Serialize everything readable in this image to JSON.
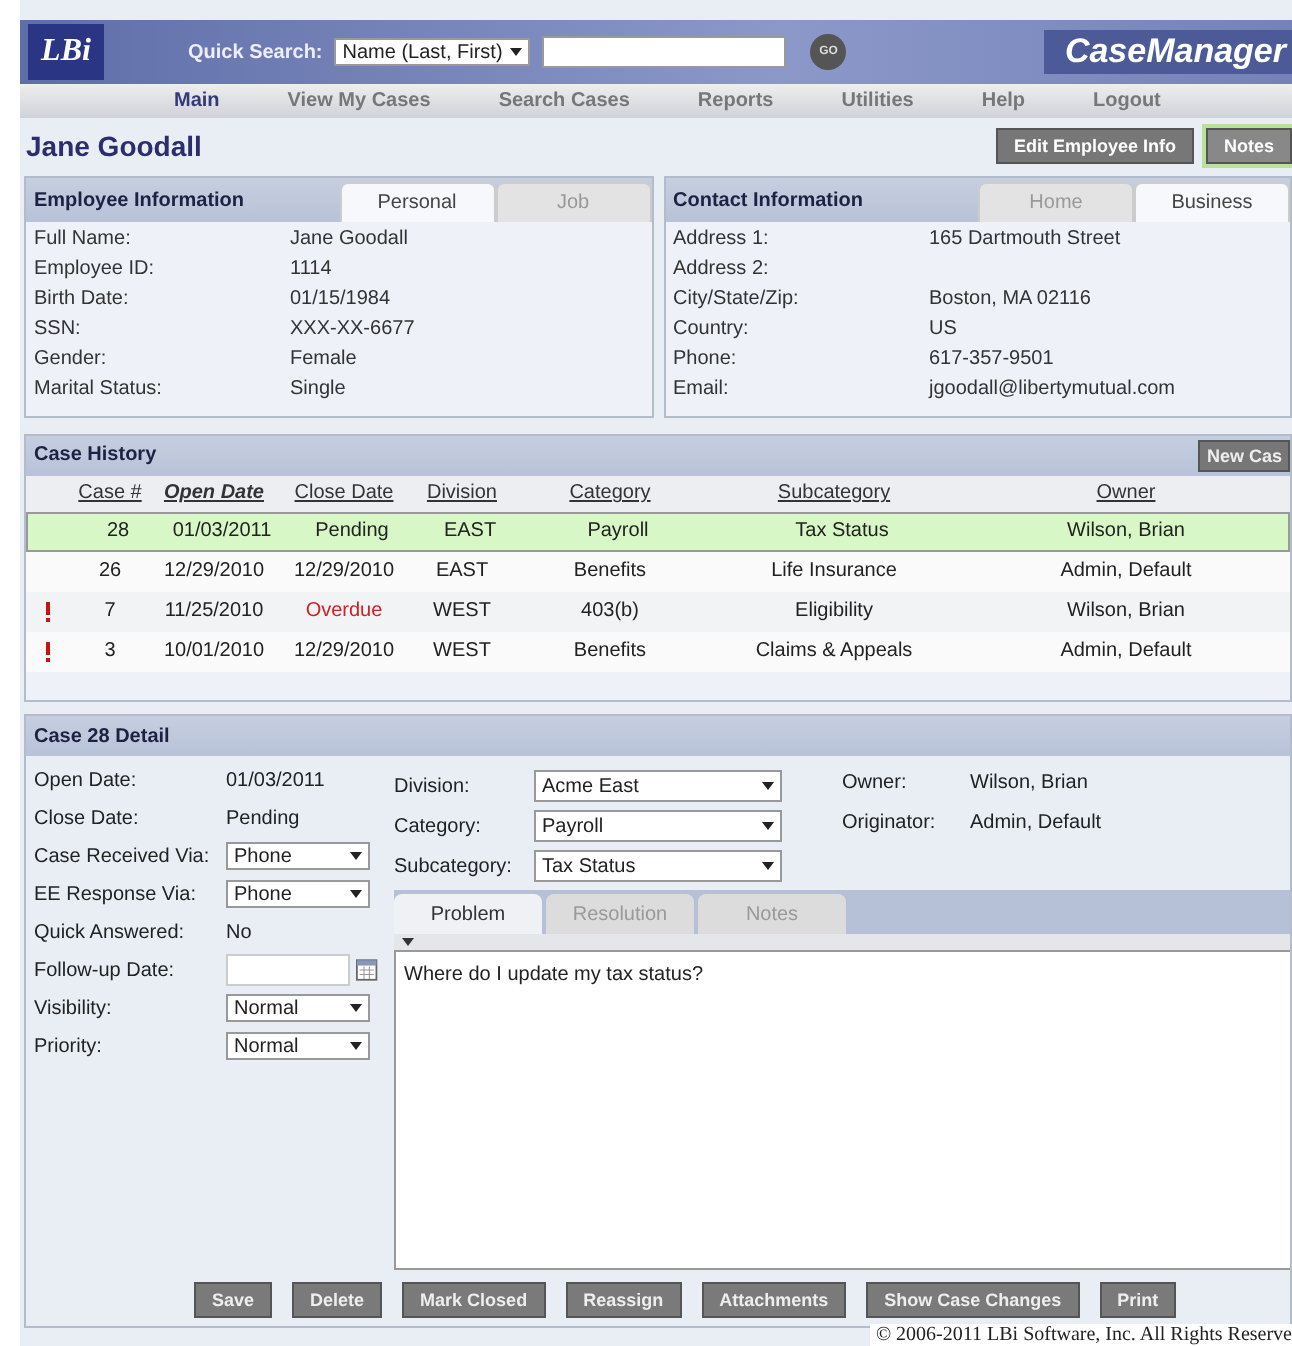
{
  "header": {
    "logo": "LBi",
    "quick_search_label": "Quick Search:",
    "search_type": "Name (Last, First)",
    "go": "GO",
    "product": "CaseManager"
  },
  "nav": [
    {
      "label": "Main",
      "selected": true
    },
    {
      "label": "View My Cases",
      "selected": false
    },
    {
      "label": "Search Cases",
      "selected": false
    },
    {
      "label": "Reports",
      "selected": false
    },
    {
      "label": "Utilities",
      "selected": false
    },
    {
      "label": "Help",
      "selected": false
    },
    {
      "label": "Logout",
      "selected": false
    }
  ],
  "employee_name": "Jane Goodall",
  "actions": [
    {
      "label": "Edit Employee Info",
      "kind": "plain"
    },
    {
      "label": "Notes",
      "kind": "highlight"
    }
  ],
  "employee_info": {
    "title": "Employee Information",
    "tabs": [
      {
        "label": "Personal",
        "selected": true
      },
      {
        "label": "Job",
        "selected": false
      }
    ],
    "fields": [
      {
        "label": "Full Name:",
        "value": "Jane Goodall"
      },
      {
        "label": "Employee ID:",
        "value": "1114"
      },
      {
        "label": "Birth Date:",
        "value": "01/15/1984"
      },
      {
        "label": "SSN:",
        "value": "XXX-XX-6677"
      },
      {
        "label": "Gender:",
        "value": "Female"
      },
      {
        "label": "Marital Status:",
        "value": "Single"
      }
    ]
  },
  "contact_info": {
    "title": "Contact Information",
    "tabs": [
      {
        "label": "Home",
        "selected": false
      },
      {
        "label": "Business",
        "selected": true
      }
    ],
    "fields": [
      {
        "label": "Address 1:",
        "value": "165 Dartmouth Street"
      },
      {
        "label": "Address 2:"
      },
      {
        "label": "City/State/Zip:",
        "value": "Boston, MA 02116"
      },
      {
        "label": "Country:",
        "value": "US"
      },
      {
        "label": "Phone:",
        "value": "617-357-9501"
      },
      {
        "label": "Email:",
        "value": "jgoodall@libertymutual.com"
      }
    ]
  },
  "case_history": {
    "title": "Case History",
    "new_button": "New Cas",
    "columns": [
      {
        "label": "Case #",
        "sorted": false
      },
      {
        "label": "Open Date",
        "sorted": true
      },
      {
        "label": "Close Date",
        "sorted": false
      },
      {
        "label": "Division",
        "sorted": false
      },
      {
        "label": "Category",
        "sorted": false
      },
      {
        "label": "Subcategory",
        "sorted": false
      },
      {
        "label": "Owner",
        "sorted": false
      }
    ],
    "rows": [
      {
        "flagged": false,
        "selected": true,
        "overdue": false,
        "cells": [
          "28",
          "01/03/2011",
          "Pending",
          "EAST",
          "Payroll",
          "Tax Status",
          "Wilson, Brian"
        ]
      },
      {
        "flagged": false,
        "selected": false,
        "overdue": false,
        "cells": [
          "26",
          "12/29/2010",
          "12/29/2010",
          "EAST",
          "Benefits",
          "Life Insurance",
          "Admin, Default"
        ]
      },
      {
        "flagged": true,
        "selected": false,
        "overdue": true,
        "cells": [
          "7",
          "11/25/2010",
          "Overdue",
          "WEST",
          "403(b)",
          "Eligibility",
          "Wilson, Brian"
        ]
      },
      {
        "flagged": true,
        "selected": false,
        "overdue": false,
        "cells": [
          "3",
          "10/01/2010",
          "12/29/2010",
          "WEST",
          "Benefits",
          "Claims & Appeals",
          "Admin, Default"
        ]
      }
    ]
  },
  "case_detail": {
    "title": "Case 28 Detail",
    "left_fields": [
      {
        "label": "Open Date:",
        "value": "01/03/2011",
        "kind": "text"
      },
      {
        "label": "Close Date:",
        "value": "Pending",
        "kind": "text"
      },
      {
        "label": "Case Received Via:",
        "value": "Phone",
        "kind": "select"
      },
      {
        "label": "EE Response Via:",
        "value": "Phone",
        "kind": "select"
      },
      {
        "label": "Quick Answered:",
        "value": "No",
        "kind": "text"
      },
      {
        "label": "Follow-up Date:",
        "kind": "date"
      },
      {
        "label": "Visibility:",
        "value": "Normal",
        "kind": "select"
      },
      {
        "label": "Priority:",
        "value": "Normal",
        "kind": "select"
      }
    ],
    "mid_fields": [
      {
        "label": "Division:",
        "value": "Acme East"
      },
      {
        "label": "Category:",
        "value": "Payroll"
      },
      {
        "label": "Subcategory:",
        "value": "Tax Status"
      }
    ],
    "right_fields": [
      {
        "label": "Owner:",
        "value": "Wilson, Brian"
      },
      {
        "label": "Originator:",
        "value": "Admin, Default"
      }
    ],
    "tabs": [
      {
        "label": "Problem",
        "selected": true
      },
      {
        "label": "Resolution",
        "selected": false
      },
      {
        "label": "Notes",
        "selected": false
      }
    ],
    "problem_text": "Where do I update my tax status?",
    "buttons": [
      "Save",
      "Delete",
      "Mark Closed",
      "Reassign",
      "Attachments",
      "Show Case Changes",
      "Print"
    ]
  },
  "copyright": "© 2006-2011 LBi Software, Inc. All Rights Reserve"
}
